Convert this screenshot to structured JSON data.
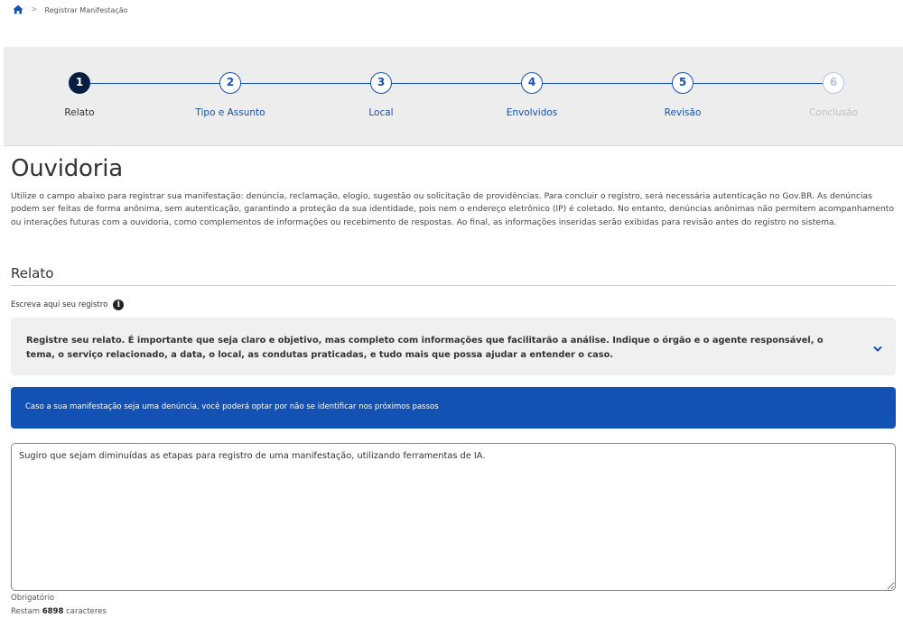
{
  "breadcrumb": {
    "home_icon": "home-icon",
    "separator": ">",
    "current": "Registrar Manifestação"
  },
  "stepper": {
    "steps": [
      {
        "number": "1",
        "label": "Relato",
        "state": "active"
      },
      {
        "number": "2",
        "label": "Tipo e Assunto",
        "state": "pending"
      },
      {
        "number": "3",
        "label": "Local",
        "state": "pending"
      },
      {
        "number": "4",
        "label": "Envolvidos",
        "state": "pending"
      },
      {
        "number": "5",
        "label": "Revisão",
        "state": "pending"
      },
      {
        "number": "6",
        "label": "Conclusão",
        "state": "disabled"
      }
    ]
  },
  "page": {
    "title": "Ouvidoria",
    "intro": "Utilize o campo abaixo para registrar sua manifestação: denúncia, reclamação, elogio, sugestão ou solicitação de providências. Para concluir o registro, será necessária autenticação no Gov.BR. As denúncias podem ser feitas de forma anônima, sem autenticação, garantindo a proteção da sua identidade, pois nem o endereço eletrônico (IP) é coletado. No entanto, denúncias anônimas não permitem acompanhamento ou interações futuras com a ouvidoria, como complementos de informações ou recebimento de respostas. Ao final, as informações inseridas serão exibidas para revisão antes do registro no sistema."
  },
  "relato": {
    "section_title": "Relato",
    "field_label": "Escreva aqui seu registro",
    "info_icon": "info-icon",
    "accordion_text": "Registre seu relato. É importante que seja claro e objetivo, mas completo com informações que facilitarão a análise. Indique o órgão e o agente responsável, o tema, o serviço relacionado, a data, o local, as condutas praticadas, e tudo mais que possa ajudar a entender o caso.",
    "accordion_icon": "chevron-down-icon",
    "notice": "Caso a sua manifestação seja uma denúncia, você poderá optar por não se identificar nos próximos passos",
    "textarea_value": "Sugiro que sejam diminuídas as etapas para registro de uma manifestação, utilizando ferramentas de IA.",
    "required_text": "Obrigatório",
    "remaining_prefix": "Restam",
    "remaining_count": "6898",
    "remaining_suffix": "caracteres"
  },
  "colors": {
    "primary": "#1351b4",
    "active_step": "#071d41",
    "stepper_bg": "#ededed",
    "notice_bg": "#1351b4",
    "accordion_bg": "#f0f0f0"
  }
}
